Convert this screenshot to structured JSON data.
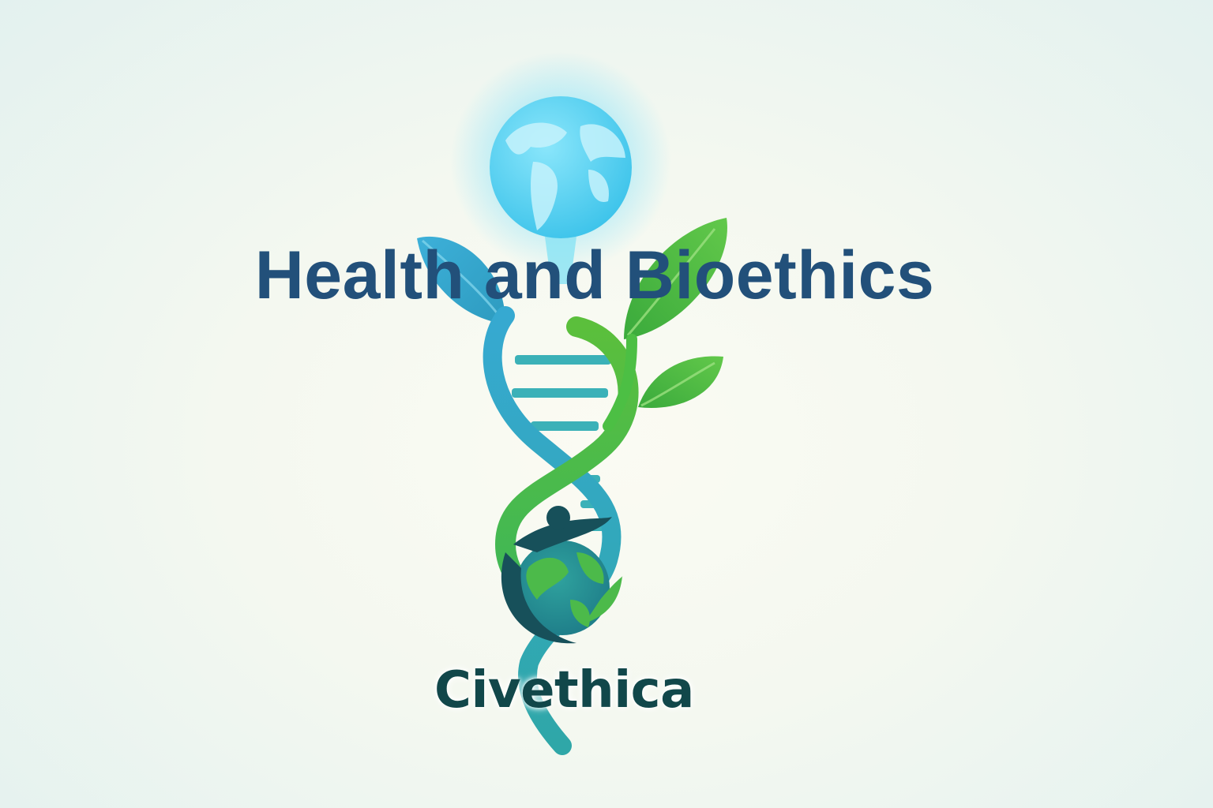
{
  "heading": {
    "title": "Health and Bioethics"
  },
  "brand": {
    "name": "Civethica"
  },
  "illustration": {
    "elements": [
      "globe-icon",
      "dna-helix",
      "leaf-icon",
      "person-globe-logo"
    ]
  },
  "colors": {
    "background": "#f6f9f1",
    "title_text": "#22507a",
    "brand_text": "#11474a",
    "helix_teal": "#2ea7b5",
    "helix_green": "#45b84a",
    "globe_blue": "#5fd0ee",
    "leaf_green": "#4cb847"
  }
}
